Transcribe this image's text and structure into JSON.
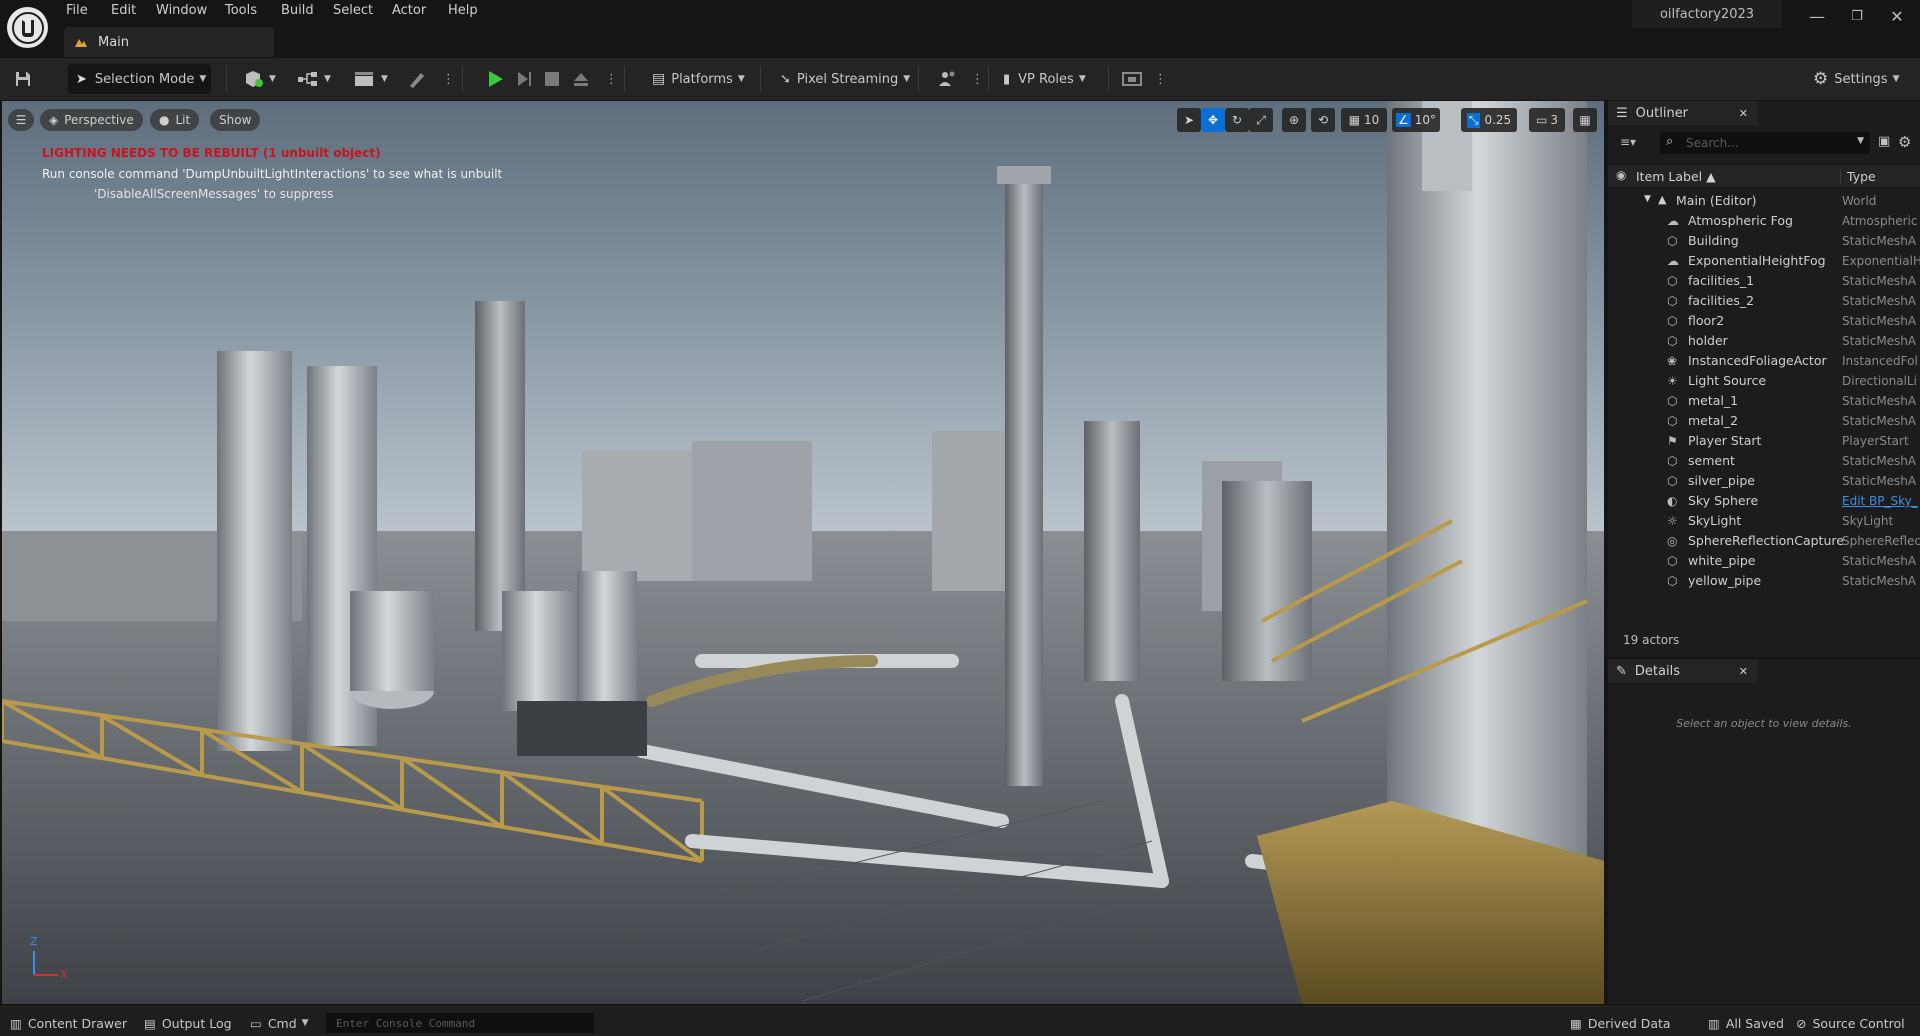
{
  "menu": [
    "File",
    "Edit",
    "Window",
    "Tools",
    "Build",
    "Select",
    "Actor",
    "Help"
  ],
  "project_name": "oilfactory2023",
  "level_tab": "Main",
  "toolbar": {
    "selection_mode": "Selection Mode",
    "platforms": "Platforms",
    "pixel_streaming": "Pixel Streaming",
    "vp_roles": "VP Roles",
    "settings": "Settings"
  },
  "viewport": {
    "perspective": "Perspective",
    "lit": "Lit",
    "show": "Show",
    "grid_snap": "10",
    "rotation_snap": "10°",
    "scale_snap": "0.25",
    "camera_speed": "3",
    "warning_title": "LIGHTING NEEDS TO BE REBUILT (1 unbuilt object)",
    "warning_line2": "Run console command 'DumpUnbuiltLightInteractions' to see what is unbuilt",
    "warning_line3": "'DisableAllScreenMessages' to suppress",
    "axis_z": "Z",
    "axis_x": "X"
  },
  "outliner": {
    "title": "Outliner",
    "search_placeholder": "Search...",
    "col_label": "Item Label ▲",
    "col_type": "Type",
    "root_label": "Main (Editor)",
    "root_type": "World",
    "items": [
      {
        "label": "Atmospheric Fog",
        "type": "Atmospheric",
        "icon": "fog-icon"
      },
      {
        "label": "Building",
        "type": "StaticMeshA",
        "icon": "static-mesh-icon"
      },
      {
        "label": "ExponentialHeightFog",
        "type": "ExponentialH",
        "icon": "fog-icon"
      },
      {
        "label": "facilities_1",
        "type": "StaticMeshA",
        "icon": "static-mesh-icon"
      },
      {
        "label": "facilities_2",
        "type": "StaticMeshA",
        "icon": "static-mesh-icon"
      },
      {
        "label": "floor2",
        "type": "StaticMeshA",
        "icon": "static-mesh-icon"
      },
      {
        "label": "holder",
        "type": "StaticMeshA",
        "icon": "static-mesh-icon"
      },
      {
        "label": "InstancedFoliageActor",
        "type": "InstancedFol",
        "icon": "foliage-icon"
      },
      {
        "label": "Light Source",
        "type": "DirectionalLi",
        "icon": "directional-light-icon"
      },
      {
        "label": "metal_1",
        "type": "StaticMeshA",
        "icon": "static-mesh-icon"
      },
      {
        "label": "metal_2",
        "type": "StaticMeshA",
        "icon": "static-mesh-icon"
      },
      {
        "label": "Player Start",
        "type": "PlayerStart",
        "icon": "player-start-icon"
      },
      {
        "label": "sement",
        "type": "StaticMeshA",
        "icon": "static-mesh-icon"
      },
      {
        "label": "silver_pipe",
        "type": "StaticMeshA",
        "icon": "static-mesh-icon"
      },
      {
        "label": "Sky Sphere",
        "type": "Edit BP_Sky_",
        "icon": "sky-sphere-icon"
      },
      {
        "label": "SkyLight",
        "type": "SkyLight",
        "icon": "skylight-icon"
      },
      {
        "label": "SphereReflectionCapture",
        "type": "SphereReflec",
        "icon": "reflection-capture-icon"
      },
      {
        "label": "white_pipe",
        "type": "StaticMeshA",
        "icon": "static-mesh-icon"
      },
      {
        "label": "yellow_pipe",
        "type": "StaticMeshA",
        "icon": "static-mesh-icon"
      }
    ],
    "actor_count": "19 actors"
  },
  "details": {
    "title": "Details",
    "empty_message": "Select an object to view details."
  },
  "statusbar": {
    "content_drawer": "Content Drawer",
    "output_log": "Output Log",
    "cmd": "Cmd",
    "console_placeholder": "Enter Console Command",
    "derived_data": "Derived Data",
    "all_saved": "All Saved",
    "source_control": "Source Control"
  },
  "colors": {
    "accent": "#0a70d6",
    "play_green": "#3cc83c",
    "warning_red": "#c8141e",
    "link_blue": "#3b8fe6"
  }
}
